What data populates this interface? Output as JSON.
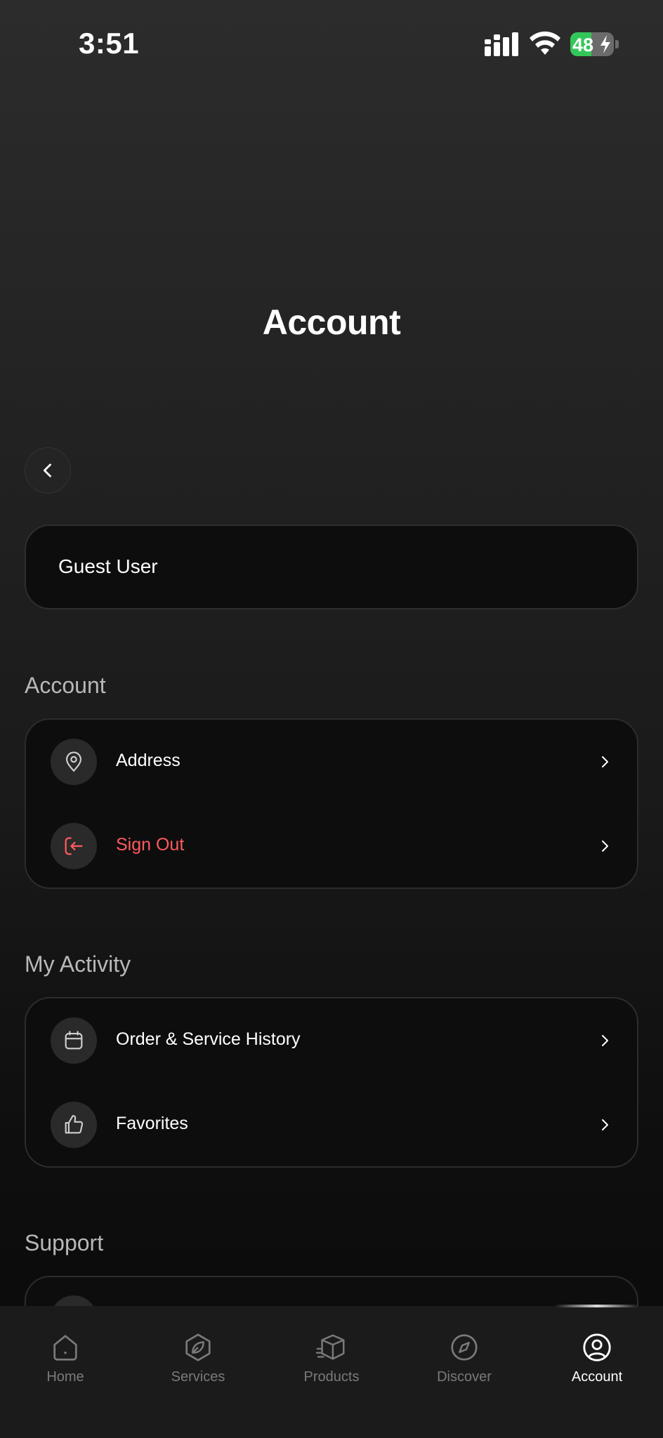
{
  "status_bar": {
    "time": "3:51",
    "battery_percent": "48",
    "battery_level": 0.48,
    "battery_color": "#33c759"
  },
  "header": {
    "title": "Account"
  },
  "user": {
    "name": "Guest User"
  },
  "sections": {
    "account": {
      "title": "Account",
      "items": [
        {
          "label": "Address",
          "icon": "location-pin-icon",
          "color": "#ffffff"
        },
        {
          "label": "Sign Out",
          "icon": "sign-out-icon",
          "color": "#ff5a5f"
        }
      ]
    },
    "activity": {
      "title": "My Activity",
      "items": [
        {
          "label": "Order & Service History",
          "icon": "calendar-icon",
          "color": "#ffffff"
        },
        {
          "label": "Favorites",
          "icon": "thumbs-up-icon",
          "color": "#ffffff"
        }
      ]
    },
    "support": {
      "title": "Support"
    }
  },
  "tabbar": {
    "tabs": [
      {
        "label": "Home",
        "icon": "home-icon",
        "active": false
      },
      {
        "label": "Services",
        "icon": "leaf-icon",
        "active": false
      },
      {
        "label": "Products",
        "icon": "box-icon",
        "active": false
      },
      {
        "label": "Discover",
        "icon": "compass-icon",
        "active": false
      },
      {
        "label": "Account",
        "icon": "user-circle-icon",
        "active": true
      }
    ]
  }
}
